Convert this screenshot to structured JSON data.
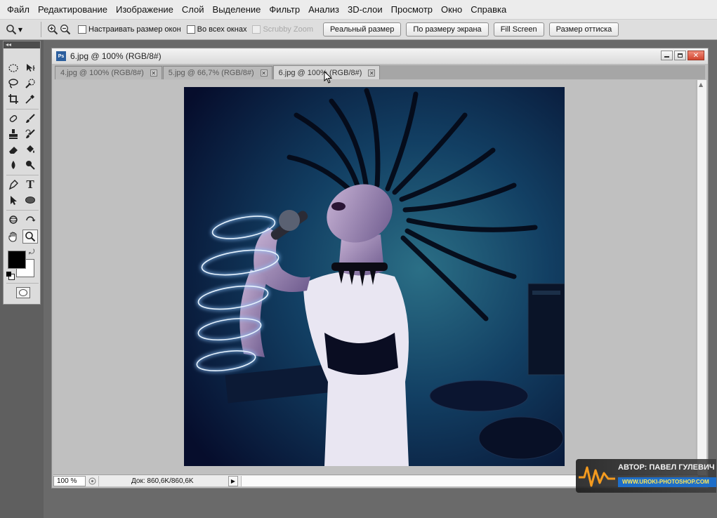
{
  "menu": [
    "Файл",
    "Редактирование",
    "Изображение",
    "Слой",
    "Выделение",
    "Фильтр",
    "Анализ",
    "3D-слои",
    "Просмотр",
    "Окно",
    "Справка"
  ],
  "options": {
    "resize_windows": "Настраивать размер окон",
    "all_windows": "Во всех окнах",
    "scrubby_zoom": "Scrubby Zoom",
    "buttons": [
      "Реальный размер",
      "По размеру экрана",
      "Fill Screen",
      "Размер оттиска"
    ]
  },
  "document": {
    "title": "6.jpg @ 100% (RGB/8#)",
    "ps_badge": "Ps",
    "tabs": [
      {
        "label": "4.jpg @ 100% (RGB/8#)",
        "active": false
      },
      {
        "label": "5.jpg @ 66,7% (RGB/8#)",
        "active": false
      },
      {
        "label": "6.jpg @ 100% (RGB/8#)",
        "active": true
      }
    ]
  },
  "status": {
    "zoom": "100 %",
    "doc_info": "Док: 860,6K/860,6K"
  },
  "watermark": {
    "author": "АВТОР: ПАВЕЛ ГУЛЕВИЧ",
    "url": "WWW.UROKI-PHOTOSHOP.COM"
  },
  "colors": {
    "foreground": "#000000",
    "background": "#ffffff"
  }
}
